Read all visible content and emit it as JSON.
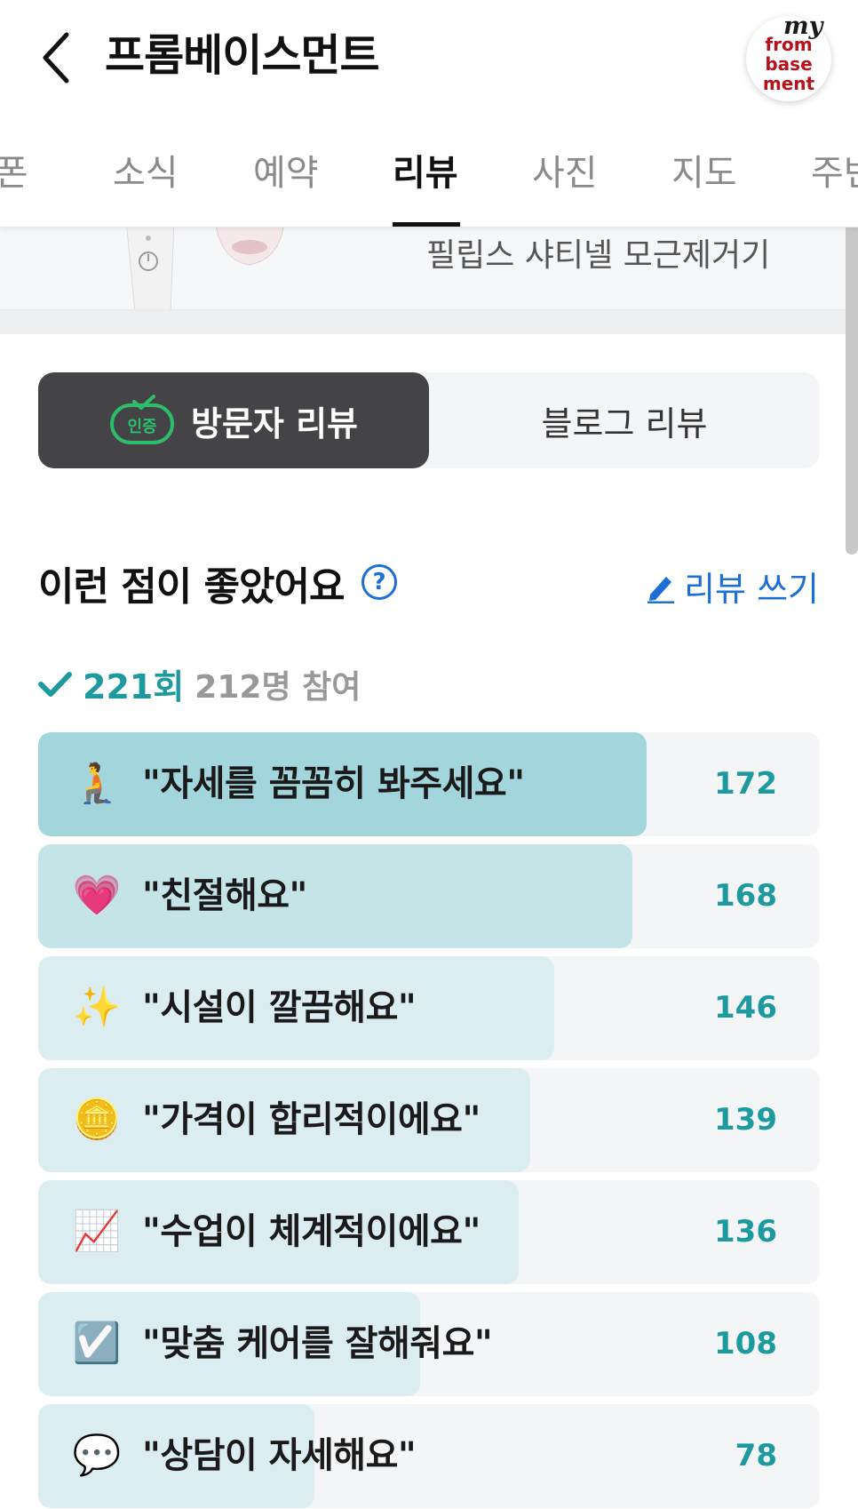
{
  "header": {
    "title": "프롬베이스먼트",
    "logo": {
      "top": "my",
      "lines": [
        "from",
        "base",
        "ment"
      ]
    }
  },
  "tabs": [
    {
      "label": "쿠폰",
      "active": false
    },
    {
      "label": "소식",
      "active": false
    },
    {
      "label": "예약",
      "active": false
    },
    {
      "label": "리뷰",
      "active": true
    },
    {
      "label": "사진",
      "active": false
    },
    {
      "label": "지도",
      "active": false
    },
    {
      "label": "주변",
      "active": false
    }
  ],
  "product": {
    "name": "필립스 샤티넬 모근제거기"
  },
  "review_toggle": {
    "badge": "인증",
    "visitor_label": "방문자 리뷰",
    "blog_label": "블로그 리뷰"
  },
  "section": {
    "title": "이런 점이 좋았어요",
    "help": "?",
    "write_label": "리뷰 쓰기"
  },
  "stats": {
    "count": "221회",
    "participants": "212명 참여"
  },
  "keywords": [
    {
      "emoji": "🧎",
      "label": "\"자세를 꼼꼼히 봐주세요\"",
      "count": "172",
      "fraction": 0.778,
      "color": "#a3d6dc"
    },
    {
      "emoji": "💗",
      "label": "\"친절해요\"",
      "count": "168",
      "fraction": 0.76,
      "color": "#c4e4e8"
    },
    {
      "emoji": "✨",
      "label": "\"시설이 깔끔해요\"",
      "count": "146",
      "fraction": 0.66,
      "color": "#dcedf1"
    },
    {
      "emoji": "🪙",
      "label": "\"가격이 합리적이에요\"",
      "count": "139",
      "fraction": 0.629,
      "color": "#dcedf1"
    },
    {
      "emoji": "📈",
      "label": "\"수업이 체계적이에요\"",
      "count": "136",
      "fraction": 0.615,
      "color": "#dcedf1"
    },
    {
      "emoji": "☑️",
      "label": "\"맞춤 케어를 잘해줘요\"",
      "count": "108",
      "fraction": 0.489,
      "color": "#dcedf1"
    },
    {
      "emoji": "💬",
      "label": "\"상담이 자세해요\"",
      "count": "78",
      "fraction": 0.353,
      "color": "#dcedf1"
    }
  ]
}
